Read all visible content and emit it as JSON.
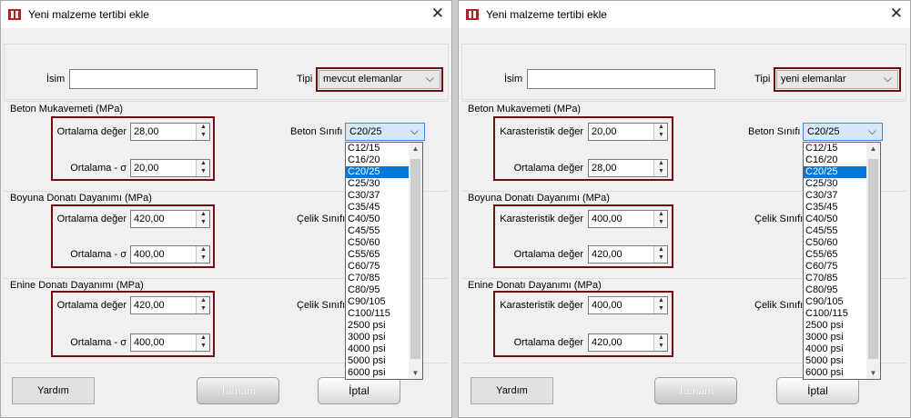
{
  "left": {
    "title": "Yeni malzeme tertibi ekle",
    "name_label": "İsim",
    "name_value": "",
    "type_label": "Tipi",
    "type_value": "mevcut elemanlar",
    "concrete": {
      "group_title": "Beton Mukavemeti (MPa)",
      "row1_label": "Ortalama değer",
      "row1_value": "28,00",
      "row2_label": "Ortalama - σ",
      "row2_value": "20,00",
      "class_label": "Beton Sınıfı",
      "class_value": "C20/25"
    },
    "long_steel": {
      "group_title": "Boyuna Donatı Dayanımı (MPa)",
      "row1_label": "Ortalama değer",
      "row1_value": "420,00",
      "row2_label": "Ortalama - σ",
      "row2_value": "400,00",
      "class_label": "Çelik Sınıfı"
    },
    "trans_steel": {
      "group_title": "Enine Donatı Dayanımı (MPa)",
      "row1_label": "Ortalama değer",
      "row1_value": "420,00",
      "row2_label": "Ortalama - σ",
      "row2_value": "400,00",
      "class_label": "Çelik Sınıfı"
    },
    "help_label": "Yardım",
    "ok_label": "Tamam",
    "cancel_label": "İptal"
  },
  "right": {
    "title": "Yeni malzeme tertibi ekle",
    "name_label": "İsim",
    "name_value": "",
    "type_label": "Tipi",
    "type_value": "yeni elemanlar",
    "concrete": {
      "group_title": "Beton Mukavemeti (MPa)",
      "row1_label": "Karasteristik değer",
      "row1_value": "20,00",
      "row2_label": "Ortalama değer",
      "row2_value": "28,00",
      "class_label": "Beton Sınıfı",
      "class_value": "C20/25"
    },
    "long_steel": {
      "group_title": "Boyuna Donatı Dayanımı (MPa)",
      "row1_label": "Karasteristik değer",
      "row1_value": "400,00",
      "row2_label": "Ortalama değer",
      "row2_value": "420,00",
      "class_label": "Çelik Sınıfı"
    },
    "trans_steel": {
      "group_title": "Enine Donatı Dayanımı (MPa)",
      "row1_label": "Karasteristik değer",
      "row1_value": "400,00",
      "row2_label": "Ortalama değer",
      "row2_value": "420,00",
      "class_label": "Çelik Sınıfı"
    },
    "help_label": "Yardım",
    "ok_label": "Tamam",
    "cancel_label": "İptal"
  },
  "concrete_classes": [
    "C12/15",
    "C16/20",
    "C20/25",
    "C25/30",
    "C30/37",
    "C35/45",
    "C40/50",
    "C45/55",
    "C50/60",
    "C55/65",
    "C60/75",
    "C70/85",
    "C80/95",
    "C90/105",
    "C100/115",
    "2500 psi",
    "3000 psi",
    "4000 psi",
    "5000 psi",
    "6000 psi"
  ],
  "selected_class_index": 2,
  "icons": {
    "app": "app-icon",
    "close": "close-icon"
  },
  "colors": {
    "highlight": "#6e0f0f",
    "selection": "#0078d7"
  }
}
